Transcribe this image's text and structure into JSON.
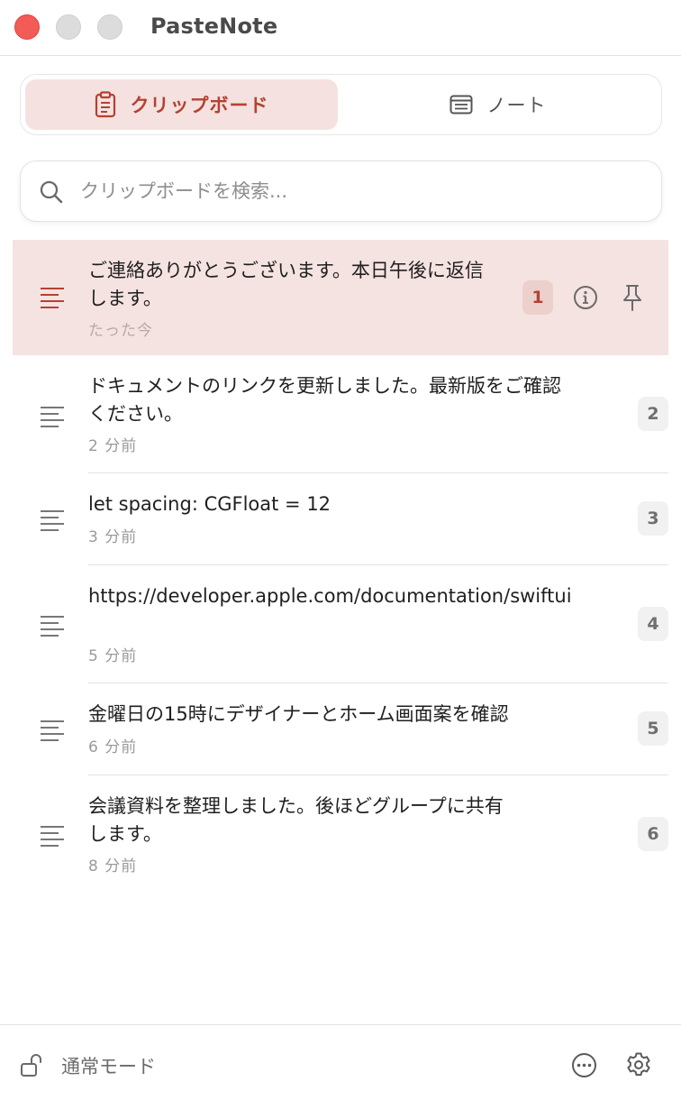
{
  "window": {
    "title": "PasteNote"
  },
  "tabs": [
    {
      "label": "クリップボード",
      "icon": "clipboard-icon",
      "active": true
    },
    {
      "label": "ノート",
      "icon": "note-icon",
      "active": false
    }
  ],
  "search": {
    "placeholder": "クリップボードを検索...",
    "value": ""
  },
  "items": [
    {
      "text": "ご連絡ありがとうございます。本日午後に返信します。",
      "time": "たった今",
      "index": "1",
      "selected": true
    },
    {
      "text": "ドキュメントのリンクを更新しました。最新版をご確認ください。",
      "time": "2 分前",
      "index": "2"
    },
    {
      "text": "let spacing: CGFloat = 12",
      "time": "3 分前",
      "index": "3"
    },
    {
      "text": "https://developer.apple.com/documentation/swiftui",
      "time": "5 分前",
      "index": "4"
    },
    {
      "text": "金曜日の15時にデザイナーとホーム画面案を確認",
      "time": "6 分前",
      "index": "5"
    },
    {
      "text": "会議資料を整理しました。後ほどグループに共有します。",
      "time": "8 分前",
      "index": "6"
    }
  ],
  "footer": {
    "mode_label": "通常モード"
  },
  "colors": {
    "accent": "#b44232",
    "selected_bg": "#f5e3e1",
    "close": "#f35b57"
  }
}
